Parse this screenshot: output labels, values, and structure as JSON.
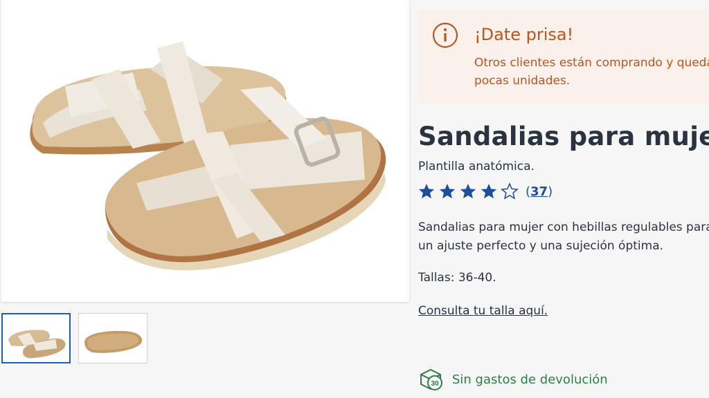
{
  "gallery": {
    "main_image_alt": "Sandalias para mujer",
    "thumbnails": [
      {
        "alt": "Sandalias vista superior",
        "active": true
      },
      {
        "alt": "Suela de la sandalia",
        "active": false
      }
    ]
  },
  "alert": {
    "icon": "info-circle-icon",
    "title": "¡Date prisa!",
    "text": "Otros clientes están comprando y quedan pocas unidades.",
    "color": "#c0541e",
    "background": "#fbf1eb"
  },
  "product": {
    "title": "Sandalias para mujer",
    "subtitle": "Plantilla anatómica.",
    "rating": {
      "value": 4,
      "max": 5,
      "count": "37",
      "open_paren": "(",
      "close_paren": ")",
      "star_color": "#1d4f9e"
    },
    "description": "Sandalias para mujer con hebillas regulables para un ajuste perfecto y una sujeción óptima.",
    "sizes": "Tallas: 36-40.",
    "size_link": "Consulta tu talla aquí."
  },
  "returns": {
    "icon": "return-box-30-icon",
    "badge": "30",
    "label": "Sin gastos de devolución",
    "color": "#2f7d48"
  }
}
